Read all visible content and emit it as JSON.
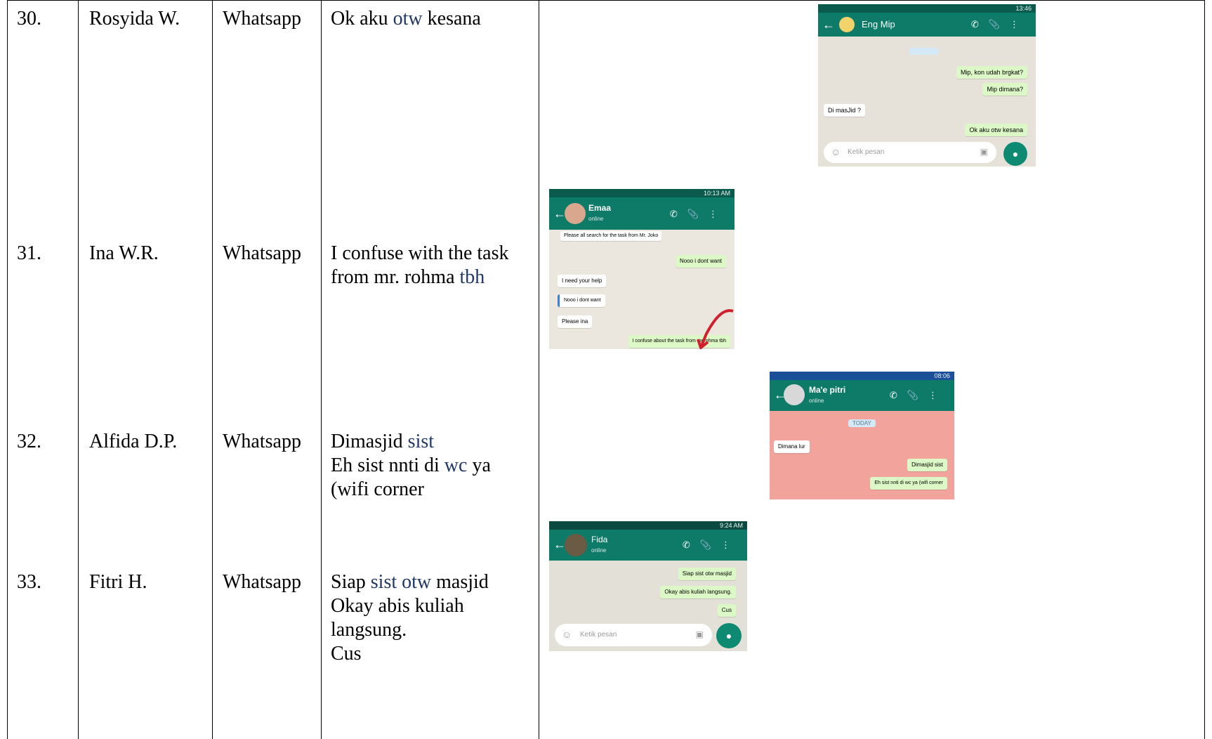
{
  "rows": [
    {
      "no": "30.",
      "name": "Rosyida W.",
      "media": "Whatsapp",
      "message_lines": [
        [
          {
            "t": "Ok aku "
          },
          {
            "t": "otw",
            "hl": true
          },
          {
            "t": " kesana"
          }
        ]
      ],
      "screenshot": {
        "status_time": "13:46",
        "contact": "Eng Mip",
        "contact_status": "",
        "date_label": "",
        "bubbles": [
          {
            "text": "Mip, kon udah brgkat?",
            "time": "",
            "dir": "out"
          },
          {
            "text": "Mip dimana?",
            "time": "",
            "dir": "out"
          },
          {
            "text": "Di masJid ?",
            "time": "",
            "dir": "in"
          },
          {
            "text": "Ok aku otw kesana",
            "time": "",
            "dir": "out"
          }
        ],
        "input_placeholder": "Ketik pesan"
      }
    },
    {
      "no": "31.",
      "name": "Ina W.R.",
      "media": "Whatsapp",
      "message_lines": [
        [
          {
            "t": "I confuse with the task"
          }
        ],
        [
          {
            "t": "from mr. rohma "
          },
          {
            "t": "tbh",
            "hl": true
          }
        ]
      ],
      "screenshot": {
        "status_time": "10:13 AM",
        "contact": "Emaa",
        "contact_status": "online",
        "date_label": "",
        "bubbles": [
          {
            "text": "Please all search for the task from Mr. Joko",
            "time": "",
            "dir": "in"
          },
          {
            "text": "Nooo i dont want",
            "time": "",
            "dir": "out"
          },
          {
            "text": "I need your help",
            "time": "",
            "dir": "in"
          },
          {
            "text": "Nooo i dont want",
            "time": "",
            "dir": "in"
          },
          {
            "text": "Please ina",
            "time": "",
            "dir": "in"
          },
          {
            "text": "I confuse about the task from mr.rohma tbh",
            "time": "",
            "dir": "out"
          }
        ],
        "input_placeholder": ""
      }
    },
    {
      "no": "32.",
      "name": "Alfida D.P.",
      "media": "Whatsapp",
      "message_lines": [
        [
          {
            "t": "Dimasjid "
          },
          {
            "t": "sist",
            "hl": true
          }
        ],
        [
          {
            "t": "Eh sist nnti di "
          },
          {
            "t": "wc",
            "hl": true
          },
          {
            "t": " ya"
          }
        ],
        [
          {
            "t": "(wifi corner"
          }
        ]
      ],
      "screenshot": {
        "status_time": "08:06",
        "contact": "Ma'e pitri",
        "contact_status": "online",
        "date_label": "TODAY",
        "bubbles": [
          {
            "text": "Dimana lur",
            "time": "",
            "dir": "in"
          },
          {
            "text": "Dimasjid sist",
            "time": "",
            "dir": "out"
          },
          {
            "text": "Eh sist nnti di wc ya (wifi corner",
            "time": "",
            "dir": "out"
          }
        ],
        "input_placeholder": ""
      }
    },
    {
      "no": "33.",
      "name": "Fitri H.",
      "media": "Whatsapp",
      "message_lines": [
        [
          {
            "t": "Siap "
          },
          {
            "t": "sist",
            "hl": true
          },
          {
            "t": " "
          },
          {
            "t": "otw",
            "hl": true
          },
          {
            "t": " masjid"
          }
        ],
        [
          {
            "t": "Okay abis kuliah"
          }
        ],
        [
          {
            "t": "langsung."
          }
        ],
        [
          {
            "t": "Cus"
          }
        ]
      ],
      "screenshot": {
        "status_time": "9:24 AM",
        "contact": "Fida",
        "contact_status": "online",
        "date_label": "",
        "bubbles": [
          {
            "text": "Siap sist otw masjid",
            "time": "",
            "dir": "out"
          },
          {
            "text": "Okay abis kuliah langsung.",
            "time": "",
            "dir": "out"
          },
          {
            "text": "Cus",
            "time": "",
            "dir": "out"
          }
        ],
        "input_placeholder": "Ketik pesan"
      }
    }
  ],
  "colors": {
    "highlight": "#1f3864",
    "whatsapp_header": "#0e7a68",
    "whatsapp_status": "#0b5a4e",
    "outgoing_bubble": "#dcf8c6",
    "chat_bg_pink": "#f2a49c"
  }
}
